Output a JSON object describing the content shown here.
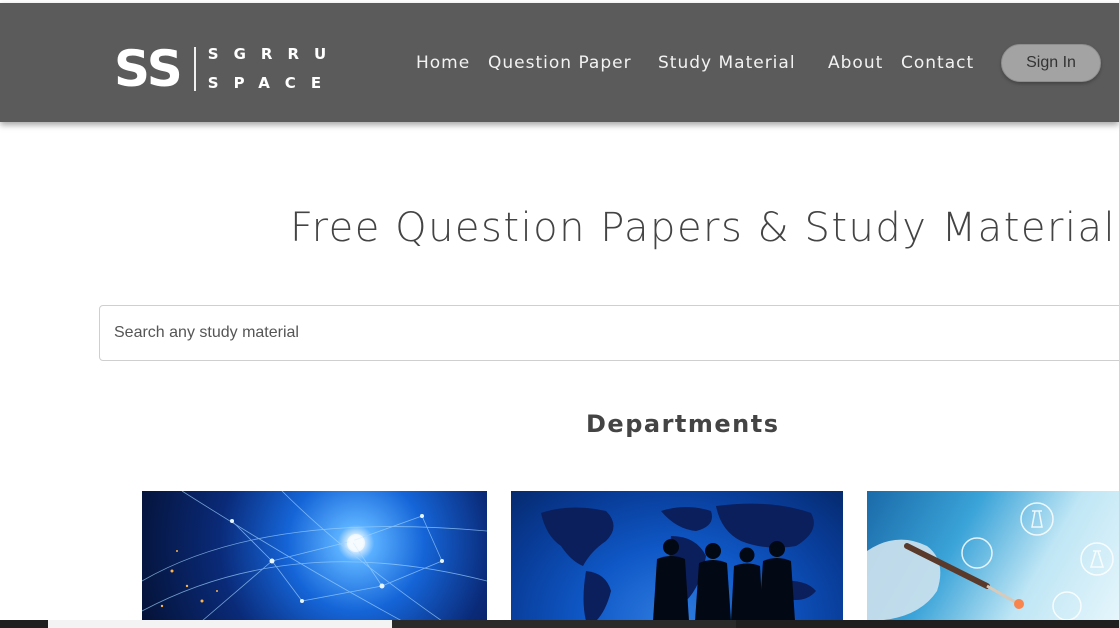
{
  "header": {
    "logo": {
      "mark": "SS",
      "line1": "SGRRU",
      "line2": "SPACE"
    },
    "nav": [
      {
        "label": "Home"
      },
      {
        "label": "Question Paper"
      },
      {
        "label": "Study Material"
      },
      {
        "label": "About"
      },
      {
        "label": "Contact"
      }
    ],
    "signin_label": "Sign In"
  },
  "hero": {
    "title": "Free Question Papers & Study Material"
  },
  "search": {
    "placeholder": "Search any study material"
  },
  "departments": {
    "title": "Departments",
    "cards": [
      {
        "image": "network-globe-image"
      },
      {
        "image": "world-map-business-image"
      },
      {
        "image": "science-lab-image"
      }
    ]
  },
  "colors": {
    "navbar": "#5b5b5b",
    "signin_bg": "#a3a3a3",
    "text": "#444444"
  }
}
